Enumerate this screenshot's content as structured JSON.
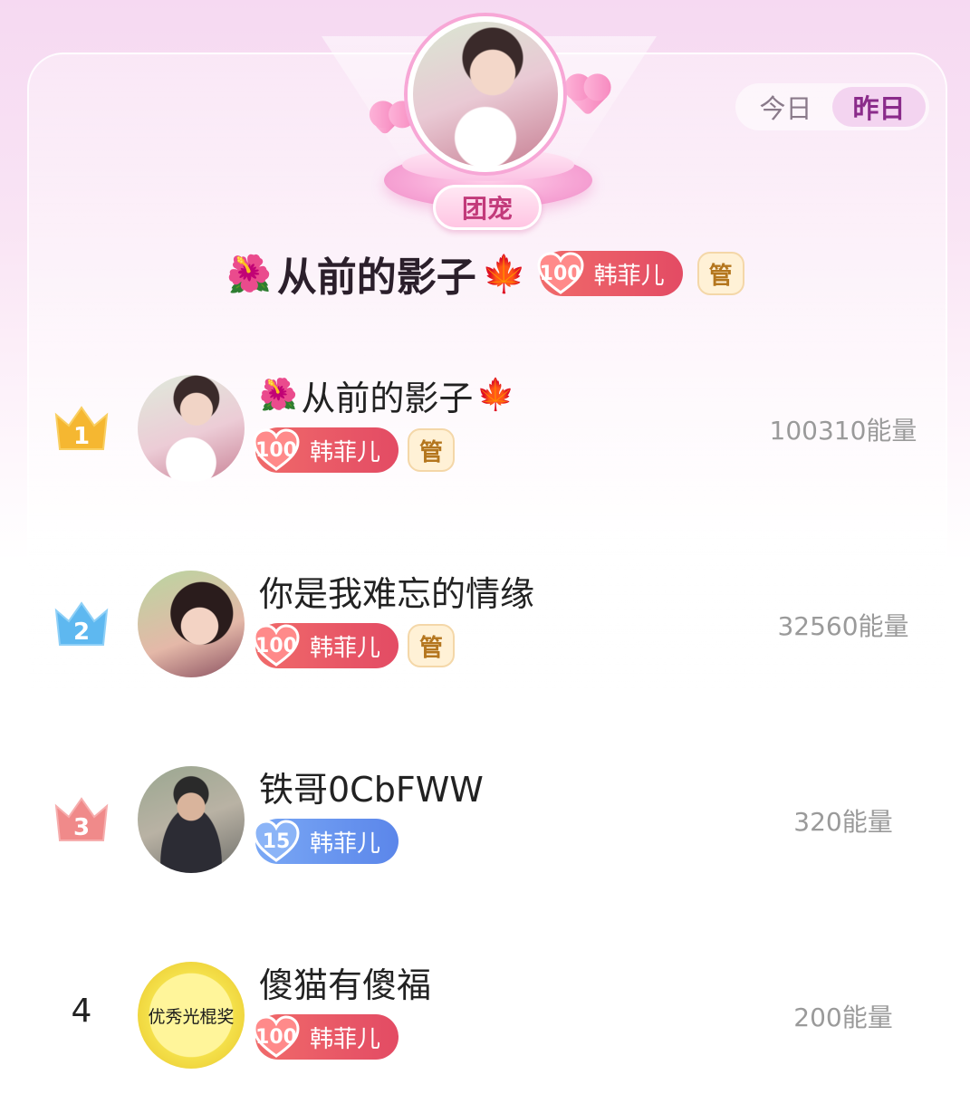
{
  "toggle": {
    "today": "今日",
    "yesterday": "昨日",
    "active": "yesterday"
  },
  "top": {
    "badge": "团宠",
    "name_prefix_emoji": "🌺",
    "name": "从前的影子",
    "name_suffix_emoji": "🍁",
    "fan_level": "100",
    "fan_name": "韩菲儿",
    "mgr": "管"
  },
  "colors": {
    "accent": "#e34b64",
    "accent_blue": "#5b86ea",
    "energy_text": "#9a9a9a"
  },
  "ranks": [
    {
      "rank": "1",
      "prefix": "🌺",
      "name": "从前的影子",
      "suffix": "🍁",
      "fan_level": "100",
      "fan_name": "韩菲儿",
      "mgr": "管",
      "energy": "100310能量"
    },
    {
      "rank": "2",
      "prefix": "",
      "name": "你是我难忘的情缘",
      "suffix": "",
      "fan_level": "100",
      "fan_name": "韩菲儿",
      "mgr": "管",
      "energy": "32560能量"
    },
    {
      "rank": "3",
      "prefix": "",
      "name": "铁哥0CbFWW",
      "suffix": "",
      "fan_level": "15",
      "fan_name": "韩菲儿",
      "mgr": "",
      "energy": "320能量"
    },
    {
      "rank": "4",
      "prefix": "",
      "name": "傻猫有傻福",
      "suffix": "",
      "fan_level": "100",
      "fan_name": "韩菲儿",
      "mgr": "",
      "energy": "200能量",
      "avatar_text": "优秀光棍奖"
    }
  ]
}
